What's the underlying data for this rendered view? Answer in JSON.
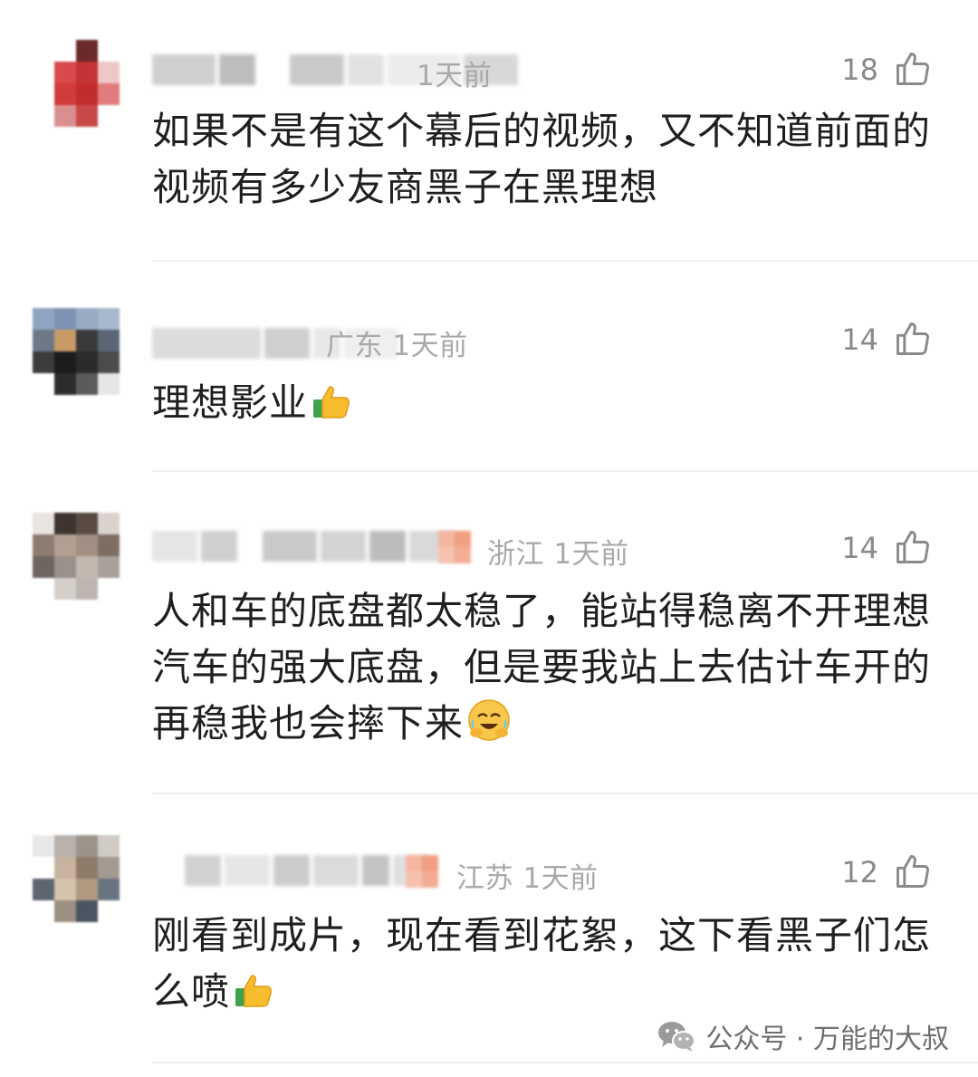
{
  "comments": [
    {
      "meta": "1天前",
      "likes": "18",
      "text": "如果不是有这个幕后的视频，又不知道前面的视频有多少友商黑子在黑理想",
      "emoji": ""
    },
    {
      "meta": "广东 1天前",
      "likes": "14",
      "text": "理想影业",
      "emoji": "thumbs-up-icon"
    },
    {
      "meta": "浙江 1天前",
      "likes": "14",
      "text": "人和车的底盘都太稳了，能站得稳离不开理想汽车的强大底盘，但是要我站上去估计车开的再稳我也会摔下来",
      "emoji": "face-with-tears-icon"
    },
    {
      "meta": "江苏 1天前",
      "likes": "12",
      "text": "刚看到成片，现在看到花絮，这下看黑子们怎么喷",
      "emoji": "thumbs-up-icon"
    }
  ],
  "watermark": {
    "label": "公众号 · 万能的大叔",
    "icon": "wechat-icon"
  },
  "colors": {
    "text": "#1f1f1f",
    "meta": "#a9a9a9",
    "like": "#8a8a8a",
    "divider": "#efefef"
  }
}
